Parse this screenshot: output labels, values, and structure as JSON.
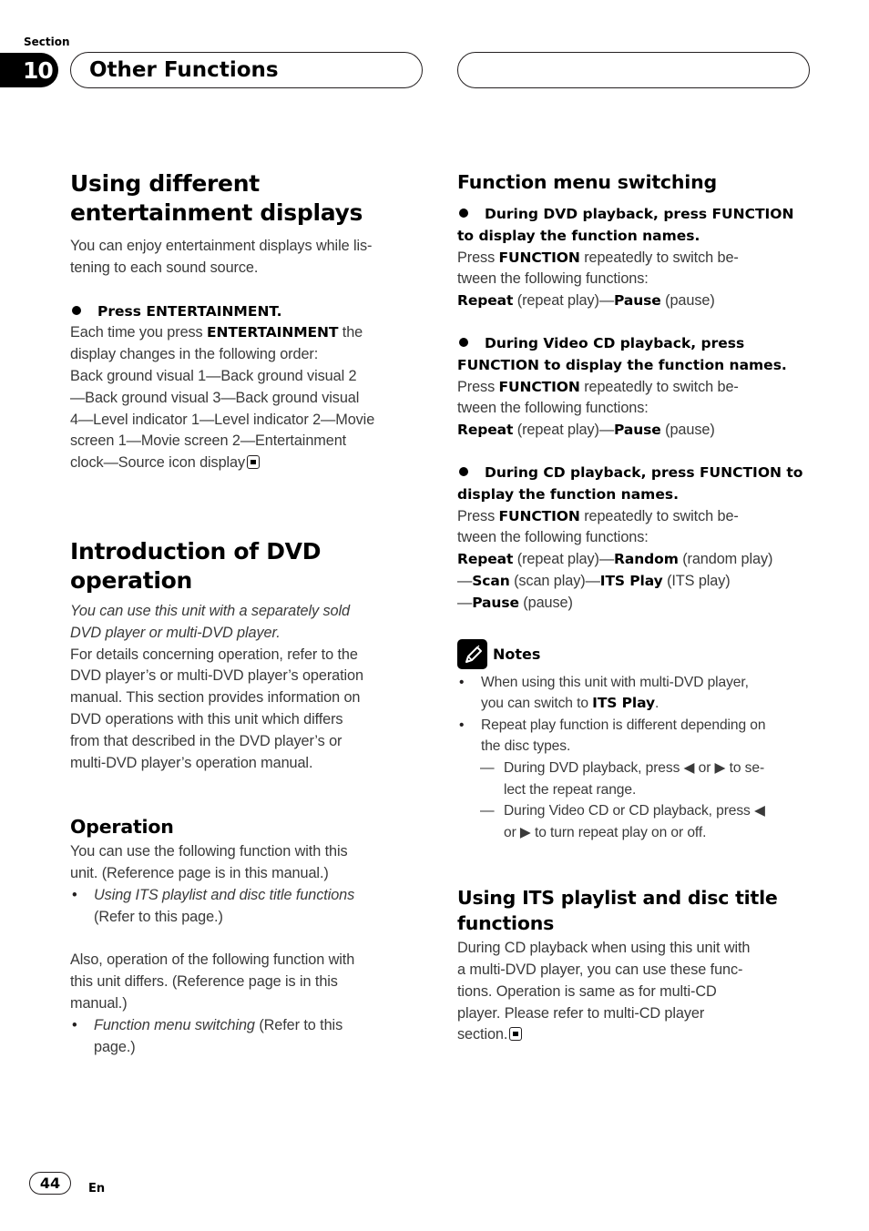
{
  "header": {
    "section_label": "Section",
    "section_number": "10",
    "section_title": "Other Functions"
  },
  "left_column": {
    "entertainment": {
      "heading_line1": "Using different",
      "heading_line2": "entertainment displays",
      "intro_line1": "You can enjoy entertainment displays while lis-",
      "intro_line2": "tening to each sound source.",
      "step": "Press ENTERTAINMENT.",
      "body_pre": "Each time you press ",
      "body_bold": "ENTERTAINMENT",
      "body_post": " the",
      "lines": [
        "display changes in the following order:",
        "Back ground visual 1—Back ground visual 2",
        "—Back ground visual 3—Back ground visual",
        "4—Level indicator 1—Level indicator 2—Movie",
        "screen 1—Movie screen 2—Entertainment",
        "clock—Source icon display"
      ]
    },
    "dvd_intro": {
      "heading": "Introduction of DVD operation",
      "italic_lines": [
        "You can use this unit with a separately sold",
        "DVD player or multi-DVD player."
      ],
      "lines": [
        "For details concerning operation, refer to the",
        "DVD player’s or multi-DVD player’s operation",
        "manual. This section provides information on",
        "DVD operations with this unit which differs",
        "from that described in the DVD player’s or",
        "multi-DVD player’s operation manual."
      ]
    },
    "operation": {
      "heading": "Operation",
      "para1_lines": [
        "You can use the following function with this",
        "unit. (Reference page is in this manual.)"
      ],
      "bullet1_italic": "Using ITS playlist and disc title functions",
      "bullet1_rest": "(Refer to this page.)",
      "para2_lines": [
        "Also, operation of the following function with",
        "this unit differs. (Reference page is in this",
        "manual.)"
      ],
      "bullet2_italic": "Function menu switching",
      "bullet2_rest_line1": " (Refer to this",
      "bullet2_rest_line2": "page.)"
    }
  },
  "right_column": {
    "function_menu": {
      "heading": "Function menu switching",
      "blocks": [
        {
          "step_line1": "During DVD playback, press FUNCTION",
          "step_line2": "to display the function names.",
          "press": "Press ",
          "function": "FUNCTION",
          "rest1": " repeatedly to switch be-",
          "rest2": "tween the following functions:",
          "seq": [
            {
              "b": "Repeat",
              "t": " (repeat play)—"
            },
            {
              "b": "Pause",
              "t": " (pause)"
            }
          ]
        },
        {
          "step_line1": "During Video CD playback, press",
          "step_line2": "FUNCTION to display the function names.",
          "press": "Press ",
          "function": "FUNCTION",
          "rest1": " repeatedly to switch be-",
          "rest2": "tween the following functions:",
          "seq": [
            {
              "b": "Repeat",
              "t": " (repeat play)—"
            },
            {
              "b": "Pause",
              "t": " (pause)"
            }
          ]
        },
        {
          "step_line1": "During CD playback, press FUNCTION to",
          "step_line2": "display the function names.",
          "press": "Press ",
          "function": "FUNCTION",
          "rest1": " repeatedly to switch be-",
          "rest2": "tween the following functions:",
          "seq_line1": [
            {
              "b": "Repeat",
              "t": " (repeat play)—"
            },
            {
              "b": "Random",
              "t": " (random play)"
            }
          ],
          "seq_line2": [
            {
              "pre": "—",
              "b": "Scan",
              "t": " (scan play)—"
            },
            {
              "b": "ITS Play",
              "t": " (ITS play)"
            }
          ],
          "seq_line3": [
            {
              "pre": "—",
              "b": "Pause",
              "t": " (pause)"
            }
          ]
        }
      ]
    },
    "notes": {
      "icon": "pencil-icon",
      "label": "Notes",
      "note1_line1": "When using this unit with multi-DVD player,",
      "note1_line2_pre": "you can switch to ",
      "note1_line2_bold": "ITS Play",
      "note1_line2_post": ".",
      "note2_line1": "Repeat play function is different depending on",
      "note2_line2": "the disc types.",
      "sub1_line1": "During DVD playback, press ◀ or ▶ to se-",
      "sub1_line2": "lect the repeat range.",
      "sub2_line1": "During Video CD or CD playback, press ◀",
      "sub2_line2": "or ▶ to turn repeat play on or off."
    },
    "its": {
      "heading_line1": "Using ITS playlist and disc title",
      "heading_line2": "functions",
      "lines": [
        "During CD playback when using this unit with",
        "a multi-DVD player, you can use these func-",
        "tions. Operation is same as for multi-CD",
        "player. Please refer to multi-CD player",
        "section."
      ]
    }
  },
  "footer": {
    "page_number": "44",
    "language": "En"
  }
}
